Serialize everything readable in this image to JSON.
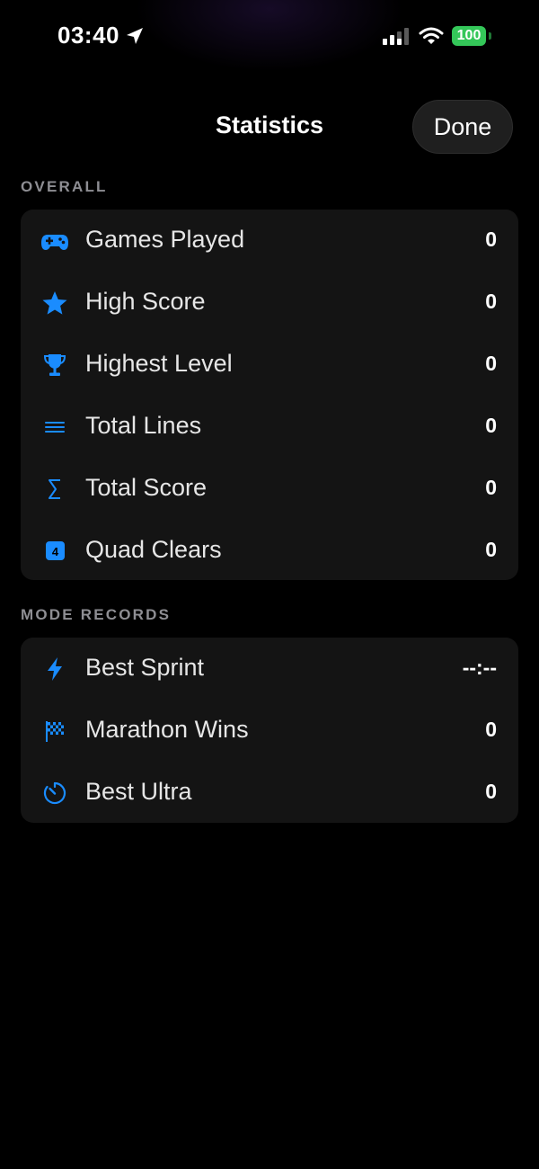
{
  "status_bar": {
    "time": "03:40",
    "battery": "100",
    "colors": {
      "battery": "#34c759"
    }
  },
  "nav": {
    "title": "Statistics",
    "done_label": "Done"
  },
  "accent_color": "#1a8cff",
  "overall": {
    "header": "OVERALL",
    "rows": [
      {
        "icon": "gamecontroller-icon",
        "label": "Games Played",
        "value": "0"
      },
      {
        "icon": "star-icon",
        "label": "High Score",
        "value": "0"
      },
      {
        "icon": "trophy-icon",
        "label": "Highest Level",
        "value": "0"
      },
      {
        "icon": "lines-icon",
        "label": "Total Lines",
        "value": "0"
      },
      {
        "icon": "sigma-icon",
        "label": "Total Score",
        "value": "0"
      },
      {
        "icon": "number-4-square-icon",
        "label": "Quad Clears",
        "value": "0",
        "icon_text": "4"
      }
    ]
  },
  "mode_records": {
    "header": "MODE RECORDS",
    "rows": [
      {
        "icon": "bolt-icon",
        "label": "Best Sprint",
        "value": "--:--"
      },
      {
        "icon": "checkered-flag-icon",
        "label": "Marathon Wins",
        "value": "0"
      },
      {
        "icon": "timer-icon",
        "label": "Best Ultra",
        "value": "0"
      }
    ]
  }
}
